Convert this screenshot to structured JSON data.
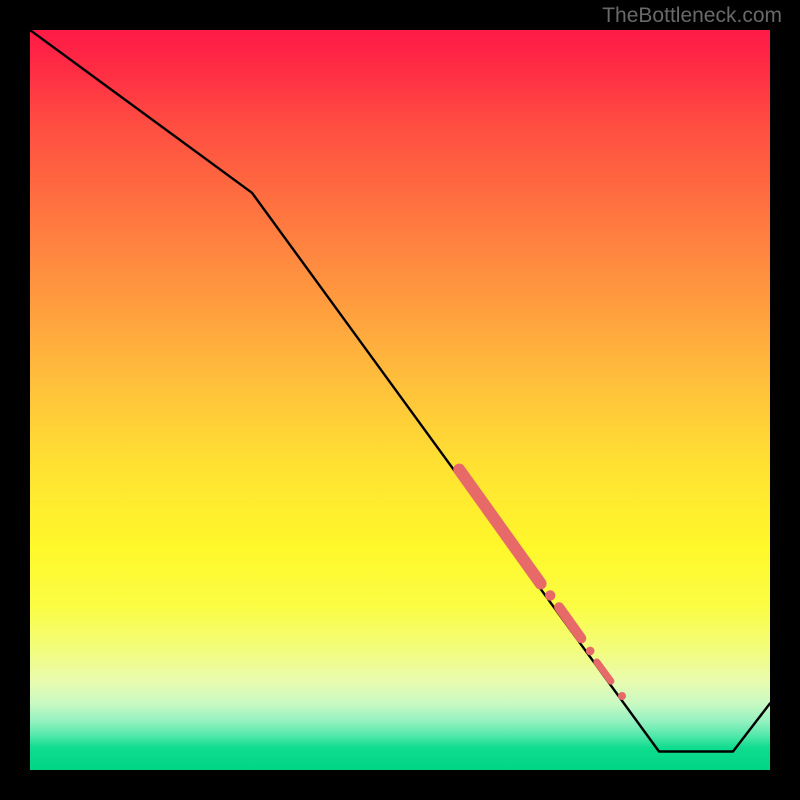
{
  "watermark": "TheBottleneck.com",
  "chart_data": {
    "type": "line",
    "x_range": [
      0,
      100
    ],
    "y_range": [
      0,
      100
    ],
    "series": [
      {
        "name": "curve",
        "points": [
          {
            "x": 0,
            "y": 100
          },
          {
            "x": 30,
            "y": 78
          },
          {
            "x": 85,
            "y": 2.5
          },
          {
            "x": 95,
            "y": 2.5
          },
          {
            "x": 100,
            "y": 9
          }
        ]
      }
    ],
    "highlight_segments": [
      {
        "x1": 58,
        "y1": 40.6,
        "x2": 69,
        "y2": 25.2,
        "w": 12
      },
      {
        "x1": 71.5,
        "y1": 22.0,
        "x2": 74.5,
        "y2": 17.8,
        "w": 10
      },
      {
        "x1": 76.6,
        "y1": 14.6,
        "x2": 78.5,
        "y2": 12.0,
        "w": 7
      }
    ],
    "highlight_points": [
      {
        "x": 70.3,
        "y": 23.6,
        "r": 5.2
      },
      {
        "x": 75.7,
        "y": 16.1,
        "r": 4.3
      },
      {
        "x": 80.0,
        "y": 10.0,
        "r": 4.0
      }
    ],
    "background_gradient": {
      "top": "#ff1a46",
      "mid": "#ffe431",
      "bottom": "#00d584"
    }
  }
}
